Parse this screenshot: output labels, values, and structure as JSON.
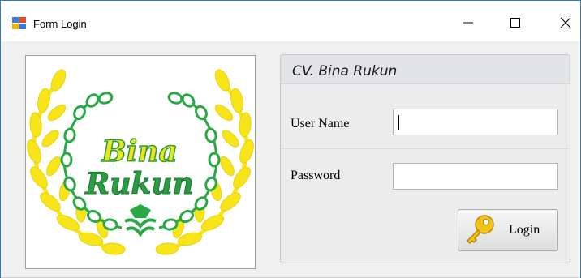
{
  "window": {
    "title": "Form Login",
    "controls": {
      "minimize": "minimize",
      "maximize": "maximize",
      "close": "close"
    }
  },
  "logo": {
    "line1": "Bina",
    "line2": "Rukun",
    "colors": {
      "laurel_outer": "#f7e51a",
      "laurel_inner": "#2aa845",
      "text_fill": "#f2e21c",
      "text_stroke": "#2a9d43"
    }
  },
  "form": {
    "group_title": "CV. Bina Rukun",
    "username": {
      "label": "User Name",
      "value": "",
      "placeholder": ""
    },
    "password": {
      "label": "Password",
      "value": "",
      "placeholder": ""
    },
    "login_button": {
      "label": "Login",
      "icon": "key-icon"
    }
  }
}
